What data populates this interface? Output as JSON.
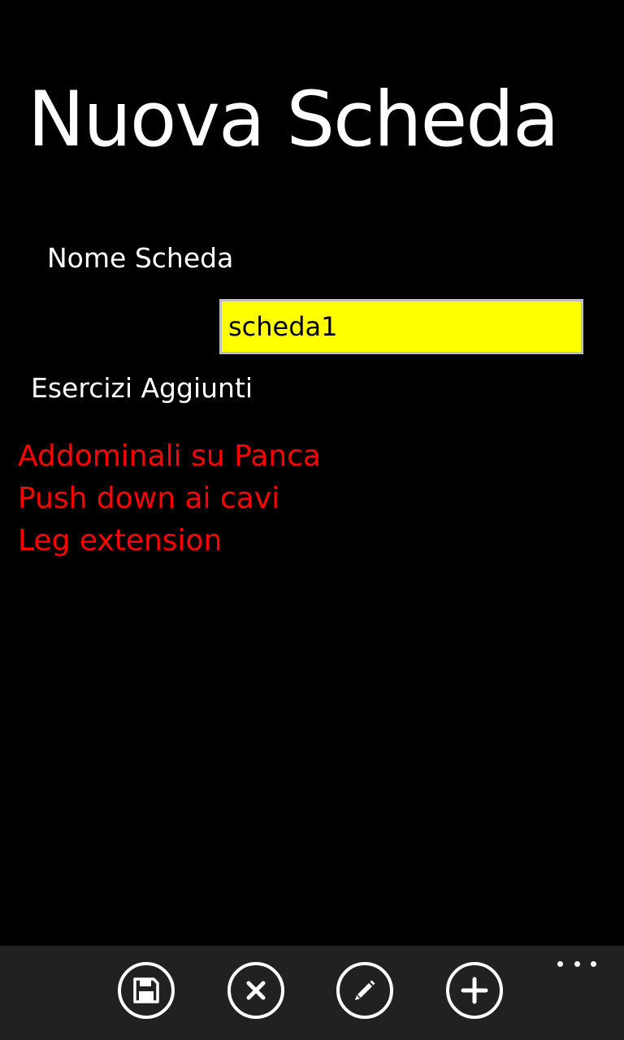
{
  "page": {
    "title": "Nuova Scheda"
  },
  "form": {
    "name_label": "Nome Scheda",
    "name_value": "scheda1",
    "exercises_label": "Esercizi Aggiunti"
  },
  "exercises": [
    "Addominali su Panca",
    "Push down ai cavi",
    "Leg extension"
  ],
  "app_bar": {
    "buttons": [
      "save-icon",
      "cancel-icon",
      "edit-icon",
      "add-icon"
    ],
    "more": "more-icon"
  },
  "colors": {
    "background": "#000000",
    "input_background": "#ffff00",
    "exercise_text": "#ff0000",
    "app_bar": "#212121"
  }
}
